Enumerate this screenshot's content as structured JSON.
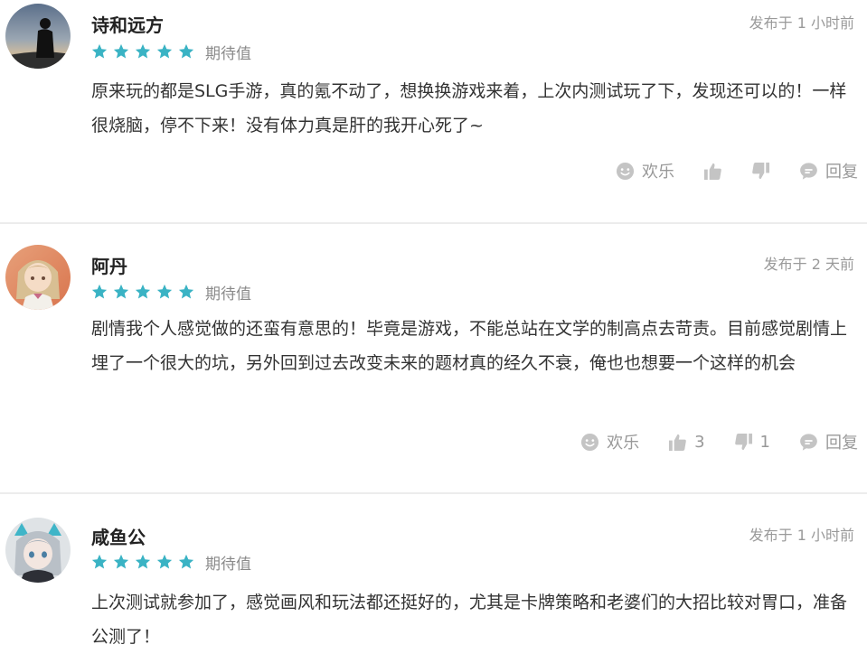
{
  "colors": {
    "star": "#3ab3c4",
    "icon": "#c4c4c4",
    "divider": "#ececec"
  },
  "reviews": [
    {
      "username": "诗和远方",
      "avatar": "silhouette-sunset-avatar",
      "rating": 5,
      "rating_label": "期待值",
      "time": "发布于 1 小时前",
      "text": "原来玩的都是SLG手游，真的氪不动了，想换换游戏来着，上次内测试玩了下，发现还可以的！一样很烧脑，停不下来！没有体力真是肝的我开心死了~",
      "actions": {
        "happy": "欢乐",
        "like_count": "",
        "dislike_count": "",
        "reply": "回复"
      }
    },
    {
      "username": "阿丹",
      "avatar": "anime-girl-avatar",
      "rating": 5,
      "rating_label": "期待值",
      "time": "发布于 2 天前",
      "text": "剧情我个人感觉做的还蛮有意思的！毕竟是游戏，不能总站在文学的制高点去苛责。目前感觉剧情上埋了一个很大的坑，另外回到过去改变未来的题材真的经久不衰，俺也也想要一个这样的机会",
      "actions": {
        "happy": "欢乐",
        "like_count": "3",
        "dislike_count": "1",
        "reply": "回复"
      }
    },
    {
      "username": "咸鱼公",
      "avatar": "anime-cat-ear-avatar",
      "rating": 5,
      "rating_label": "期待值",
      "time": "发布于 1 小时前",
      "text": "上次测试就参加了，感觉画风和玩法都还挺好的，尤其是卡牌策略和老婆们的大招比较对胃口，准备公测了！"
    }
  ]
}
